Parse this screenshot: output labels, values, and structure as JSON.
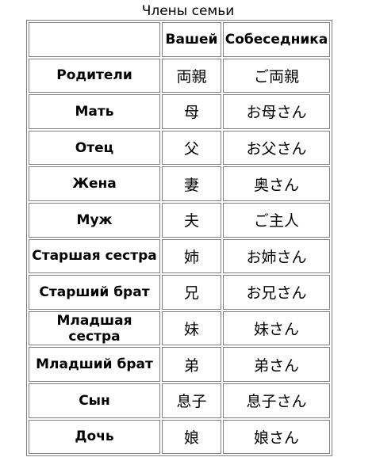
{
  "caption": "Члены семьи",
  "headers": [
    "",
    "Вашей",
    "Собеседника"
  ],
  "rows": [
    {
      "term": "Родители",
      "own": "両親",
      "others": "ご両親"
    },
    {
      "term": "Мать",
      "own": "母",
      "others": "お母さん"
    },
    {
      "term": "Отец",
      "own": "父",
      "others": "お父さん"
    },
    {
      "term": "Жена",
      "own": "妻",
      "others": "奥さん"
    },
    {
      "term": "Муж",
      "own": "夫",
      "others": "ご主人"
    },
    {
      "term": "Старшая сестра",
      "own": "姉",
      "others": "お姉さん"
    },
    {
      "term": "Старший брат",
      "own": "兄",
      "others": "お兄さん"
    },
    {
      "term": "Младшая сестра",
      "own": "妹",
      "others": "妹さん"
    },
    {
      "term": "Младший брат",
      "own": "弟",
      "others": "弟さん"
    },
    {
      "term": "Сын",
      "own": "息子",
      "others": "息子さん"
    },
    {
      "term": "Дочь",
      "own": "娘",
      "others": "娘さん"
    }
  ]
}
